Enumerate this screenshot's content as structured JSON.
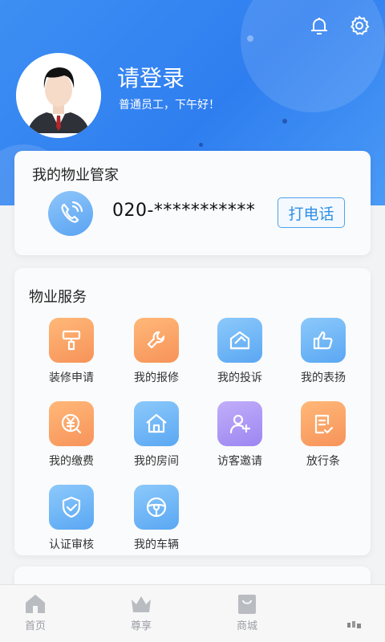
{
  "header": {
    "login_title": "请登录",
    "greeting": "普通员工，下午好！",
    "icons": [
      "bell-icon",
      "settings-icon"
    ]
  },
  "manager_card": {
    "title": "我的物业管家",
    "phone": "020-***********",
    "call_label": "打电话"
  },
  "services": {
    "title": "物业服务",
    "items": [
      {
        "label": "装修申请",
        "icon": "paint-roller-icon",
        "color": "orange"
      },
      {
        "label": "我的报修",
        "icon": "wrench-icon",
        "color": "orange"
      },
      {
        "label": "我的投诉",
        "icon": "envelope-icon",
        "color": "blue"
      },
      {
        "label": "我的表扬",
        "icon": "thumbs-up-icon",
        "color": "blue"
      },
      {
        "label": "我的缴费",
        "icon": "yuan-payment-icon",
        "color": "orange"
      },
      {
        "label": "我的房间",
        "icon": "house-icon",
        "color": "blue"
      },
      {
        "label": "访客邀请",
        "icon": "add-user-icon",
        "color": "purple"
      },
      {
        "label": "放行条",
        "icon": "pass-document-icon",
        "color": "orange"
      },
      {
        "label": "认证审核",
        "icon": "shield-check-icon",
        "color": "blue"
      },
      {
        "label": "我的车辆",
        "icon": "steering-wheel-icon",
        "color": "blue"
      }
    ]
  },
  "tabbar": {
    "items": [
      {
        "label": "首页",
        "icon": "home-icon"
      },
      {
        "label": "尊享",
        "icon": "crown-icon"
      },
      {
        "label": "商城",
        "icon": "shopping-bag-icon"
      }
    ]
  },
  "colors": {
    "hero": "#3a8bf2",
    "accent": "#2f8fe6",
    "orange": "#f7935a",
    "blue": "#5aa7f3",
    "purple": "#9c86f2"
  }
}
